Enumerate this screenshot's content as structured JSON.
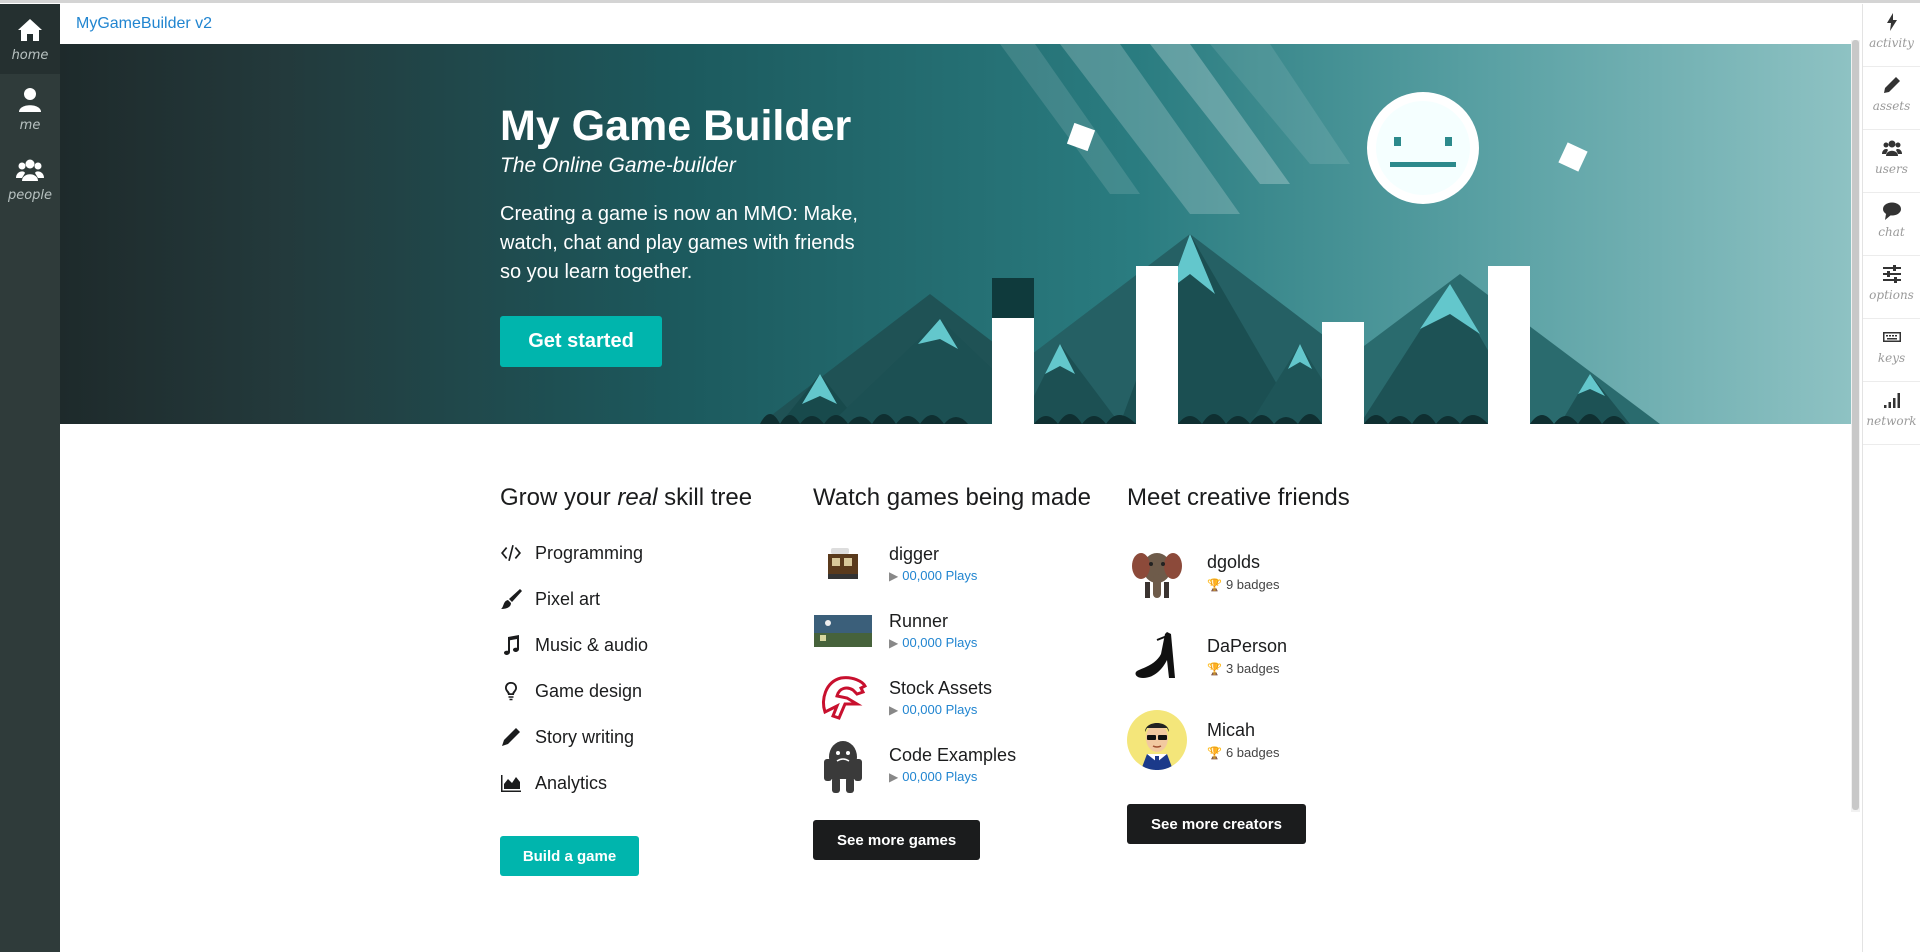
{
  "app": {
    "title": "MyGameBuilder v2"
  },
  "left_nav": {
    "items": [
      {
        "label": "home",
        "icon": "home-icon"
      },
      {
        "label": "me",
        "icon": "user-icon"
      },
      {
        "label": "people",
        "icon": "users-icon"
      }
    ]
  },
  "right_nav": {
    "items": [
      {
        "label": "activity",
        "icon": "bolt-icon"
      },
      {
        "label": "assets",
        "icon": "pencil-icon"
      },
      {
        "label": "users",
        "icon": "users-icon"
      },
      {
        "label": "chat",
        "icon": "chat-icon"
      },
      {
        "label": "options",
        "icon": "sliders-icon"
      },
      {
        "label": "keys",
        "icon": "keyboard-icon"
      },
      {
        "label": "network",
        "icon": "signal-icon"
      }
    ]
  },
  "hero": {
    "title": "My Game Builder",
    "subtitle": "The Online Game-builder",
    "description": "Creating a game is now an MMO: Make, watch, chat and play games with friends so you learn together.",
    "cta_label": "Get started",
    "colors": {
      "cta": "#00b5ad"
    }
  },
  "skills": {
    "heading_prefix": "Grow your ",
    "heading_emphasis": "real",
    "heading_suffix": " skill tree",
    "items": [
      {
        "label": "Programming",
        "icon": "code-icon"
      },
      {
        "label": "Pixel art",
        "icon": "paintbrush-icon"
      },
      {
        "label": "Music & audio",
        "icon": "music-note-icon"
      },
      {
        "label": "Game design",
        "icon": "lightbulb-icon"
      },
      {
        "label": "Story writing",
        "icon": "pencil-icon"
      },
      {
        "label": "Analytics",
        "icon": "area-chart-icon"
      }
    ],
    "button_label": "Build a game"
  },
  "games": {
    "heading": "Watch games being made",
    "items": [
      {
        "name": "digger",
        "plays": "00,000 Plays",
        "thumb": "digger-thumb"
      },
      {
        "name": "Runner",
        "plays": "00,000 Plays",
        "thumb": "runner-thumb"
      },
      {
        "name": "Stock Assets",
        "plays": "00,000 Plays",
        "thumb": "stock-assets-thumb"
      },
      {
        "name": "Code Examples",
        "plays": "00,000 Plays",
        "thumb": "code-examples-thumb"
      }
    ],
    "button_label": "See more games"
  },
  "friends": {
    "heading": "Meet creative friends",
    "items": [
      {
        "name": "dgolds",
        "badges": "9 badges",
        "avatar": "elephant-avatar"
      },
      {
        "name": "DaPerson",
        "badges": "3 badges",
        "avatar": "shoe-avatar"
      },
      {
        "name": "Micah",
        "badges": "6 badges",
        "avatar": "sunglasses-man-avatar"
      }
    ],
    "button_label": "See more creators"
  }
}
